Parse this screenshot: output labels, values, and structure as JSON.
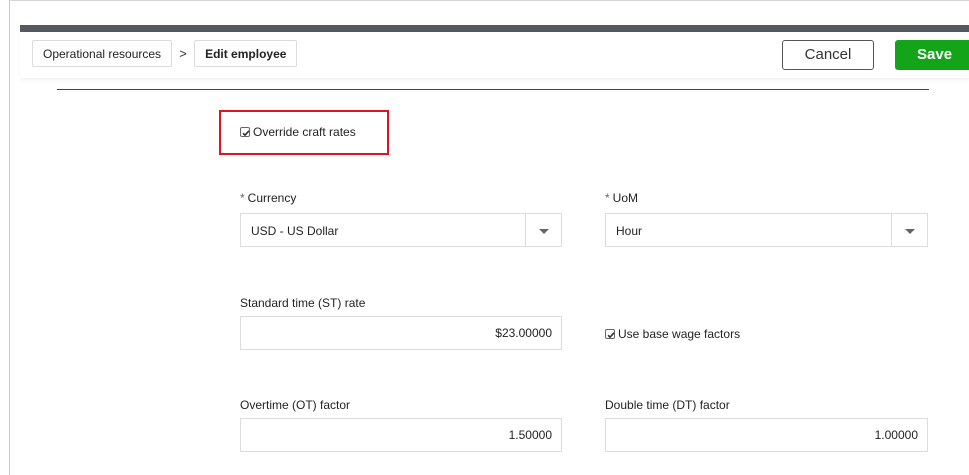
{
  "breadcrumb": {
    "items": [
      "Operational resources",
      "Edit employee"
    ],
    "separator": ">"
  },
  "toolbar": {
    "cancel_label": "Cancel",
    "save_label": "Save"
  },
  "form": {
    "override_craft_rates": {
      "label": "Override craft rates",
      "checked": true
    },
    "currency": {
      "label": "Currency",
      "required_mark": "*",
      "value": "USD - US Dollar"
    },
    "uom": {
      "label": "UoM",
      "required_mark": "*",
      "value": "Hour"
    },
    "st_rate": {
      "label": "Standard time (ST) rate",
      "value": "$23.00000"
    },
    "use_base_wage_factors": {
      "label": "Use base wage factors",
      "checked": true
    },
    "ot_factor": {
      "label": "Overtime (OT) factor",
      "value": "1.50000"
    },
    "dt_factor": {
      "label": "Double time (DT) factor",
      "value": "1.00000"
    }
  },
  "colors": {
    "save_button": "#14a41a",
    "highlight": "#e0141e",
    "topbar": "#555a5f"
  }
}
